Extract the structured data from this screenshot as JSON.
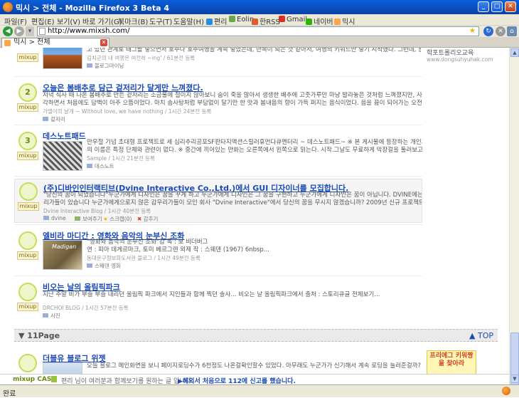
{
  "window": {
    "title": "믹시 > 전체 - Mozilla Firefox 3 Beta 4"
  },
  "menu": {
    "items": [
      "파일(F)",
      "편집(E)",
      "보기(V)",
      "바로 가기(G)",
      "북마크(B)",
      "도구(T)",
      "도움말(H)"
    ],
    "bookmarks": [
      "편리",
      "Eolin",
      "한RSS",
      "Gmail",
      "네이버",
      "믹시"
    ]
  },
  "nav": {
    "url": "http://www.mixsh.com/"
  },
  "tab": {
    "label": "믹시 > 전체"
  },
  "posts": [
    {
      "count": "",
      "badge_label": "mixup",
      "title": "",
      "body": [
        "고 있던 관계로 태그를 넣으면서 호주나 호주여행을 계속 넣었는데, 반복이 되는 것 같아서, 여행의 키워드만 넣기 시작했다. 그런데, 블로그"
      ],
      "meta": "김치군의 내 여행은 여전히 ~ing' / 61분전 등록",
      "tags": "블로그마이닝"
    },
    {
      "count": "2",
      "badge_label": "mixup",
      "title": "오늘은 봄배추로 담근 겉저리가 달게만 느껴졌다.",
      "body": [
        "저녁 식사 때 나온 봄배추로 만든 겉저리는 소금물에 절이지 않아보니 숨이 죽을 않아서 생생한 배추에 고춧가루만 마냥 발라놓은 것처럼 느껴졌지만, 사각사",
        "각하면서 처음에도 담백이 아주 으뜸이었다. 마치 솜사탕처럼 부담없이 달기만 한 맛과 봄내음의 향이 가득 퍼지는 음식이었다. 음을 끓이 되어가는 오전에 국도 칼칼"
      ],
      "meta": "가엘이의 날개 ~ Without love, we have nothing / 1시간 24분전 등록",
      "tags": "겉저리"
    },
    {
      "count": "3",
      "badge_label": "mixup",
      "title": "데스노트패드",
      "body": [
        "만우절 기념 초대형 프로젝트로 세 심리추리공포SF판타지액션스릴러휴먼다큐멘터리 ~ 데스노트패드~ ※ 본 게시물에 등장하는 개인과 단체",
        "의 이름은 특정 단체와 관련이 없다. ※ 중간에 끼어있는 만화는 오른쪽에서 왼쪽으로 읽는다. 시작.그날도 무료하게 막장걸을 둘러보고 있던"
      ],
      "meta": "Sample / 1시간 21분전 등록",
      "tags": "데스노트"
    },
    {
      "count": "",
      "badge_label": "mixup",
      "title": "(주)디바인인터랙티브(Dvine Interactive Co.,Ltd.)에서 GUI 디자이너를 모집합니다.",
      "body": [
        "\"당신의 꿈이 되었습니다\"누군가에게 디자인은 꿈을 꾸게 하고 누군가에게 디자인은 그 꿈을 구현하고 누군가에게 디자인은 꿈이 아닙니다.  DVINE에는 잠우",
        "리가들이 있습니다 누군가에게으로지 않은 감우리가들이 모인 회사 \"Dvine Interactive\"에서 당신의 꿈을 무시지 않겠습니까? 2009년 신규 프로젝트를 함께할 실력"
      ],
      "meta": "Dvine Interactive Blog / 1시간 40분전 등록",
      "tags": "dvine",
      "actions": [
        "보여주기",
        "스크랩(0)",
        "감추기"
      ]
    },
    {
      "count": "",
      "badge_label": "mixup",
      "title": "엘비라 마디간 : 영화와 음악의 눈부신 조화",
      "body": [
        "\"영화와 음악의 눈부신 조화\"감   독 : 보 비더버그",
        "연 : 피아 데게르마크, 토미 베르그렌 외제   작 : 스웨덴 (1967) 6nbsp..."
      ],
      "meta": "동대문구정보화도서관 블로그 / 1시간 49분전 등록",
      "tags": "스웨덴 영화"
    },
    {
      "count": "",
      "badge_label": "mixup",
      "title": "비오는 날의 올림픽파크",
      "body": [
        "지난 주말 비가 부슬 부슬 내리던 올림픽 파크에서 지인들과 함께 찍던 솔사... 비오는 날 올림픽파크에서 출처 : 스토리큐글 전체보기..."
      ],
      "meta": "DRCHOI BLOG / 1시간 57분전 등록",
      "tags": "사진"
    }
  ],
  "right_ad_text": "학포트롤리오교육",
  "right_ad_url": "www.dongsuhyuhak.com",
  "pagebar": {
    "label": "11Page",
    "top": "TOP"
  },
  "next_post": {
    "title": "더블유 블로그 위젯",
    "body": "오늘 블로그 메인화면을 보니 페이지로딩수가 6천정도 나온걸확인할수 있었다. 아무래도 누군가가 신기해서 계속 로딩을 눌러준걸까?   아"
  },
  "bottom_ad": "프리에그 키워짱을 찾아라",
  "cast": {
    "label": "mixup CAST",
    "text": "편리 님이 여러분과 함께보기를 원하는 글 입니다.",
    "link": "해외서 처음으로 112에 신고를 했습니다."
  },
  "status": {
    "text": "완료"
  },
  "colors": {
    "link": "#1a4ab4",
    "badge_border": "#c8dc5a",
    "titlebar": "#0a5fd8"
  }
}
